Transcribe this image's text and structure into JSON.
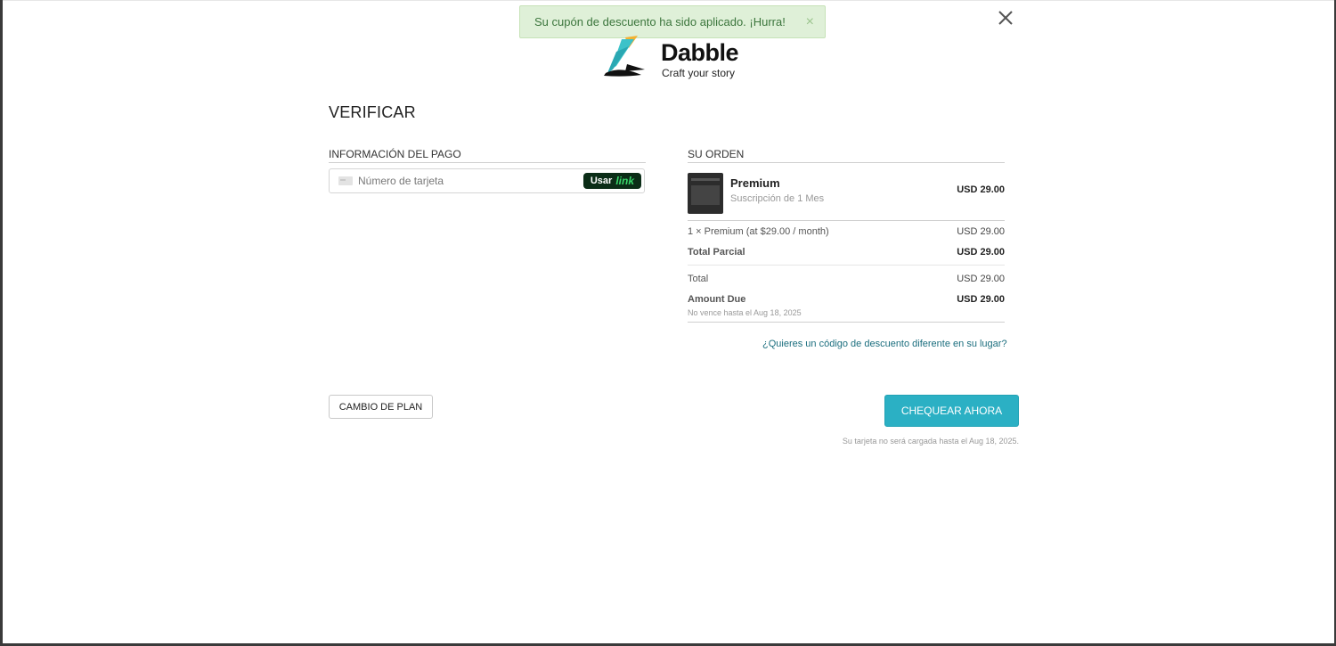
{
  "toast": {
    "message": "Su cupón de descuento ha sido aplicado. ¡Hurra!",
    "close": "×"
  },
  "brand": {
    "name": "Dabble",
    "tagline": "Craft your story",
    "colors": {
      "accent": "#2bb0c4",
      "logo_teal": "#3cc2c9",
      "logo_yellow": "#f2b233"
    }
  },
  "page": {
    "heading": "VERIFICAR"
  },
  "payment": {
    "section_label": "INFORMACIÓN DEL PAGO",
    "card_placeholder": "Número de tarjeta",
    "link_button_prefix": "Usar",
    "link_button_brand": "link"
  },
  "order": {
    "section_label": "SU ORDEN",
    "product_name": "Premium",
    "product_sub": "Suscripción de 1 Mes",
    "product_price": "USD 29.00",
    "line_item": "1 × Premium (at $29.00 / month)",
    "line_item_price": "USD 29.00",
    "subtotal_label": "Total Parcial",
    "subtotal_value": "USD 29.00",
    "total_label": "Total",
    "total_value": "USD 29.00",
    "amount_due_label": "Amount Due",
    "amount_due_value": "USD 29.00",
    "due_note": "No vence hasta el Aug 18, 2025",
    "discount_link": "¿Quieres un código de descuento diferente en su lugar?"
  },
  "actions": {
    "change_plan": "CAMBIO DE PLAN",
    "checkout": "CHEQUEAR AHORA",
    "charge_note": "Su tarjeta no será cargada hasta el Aug 18, 2025."
  }
}
